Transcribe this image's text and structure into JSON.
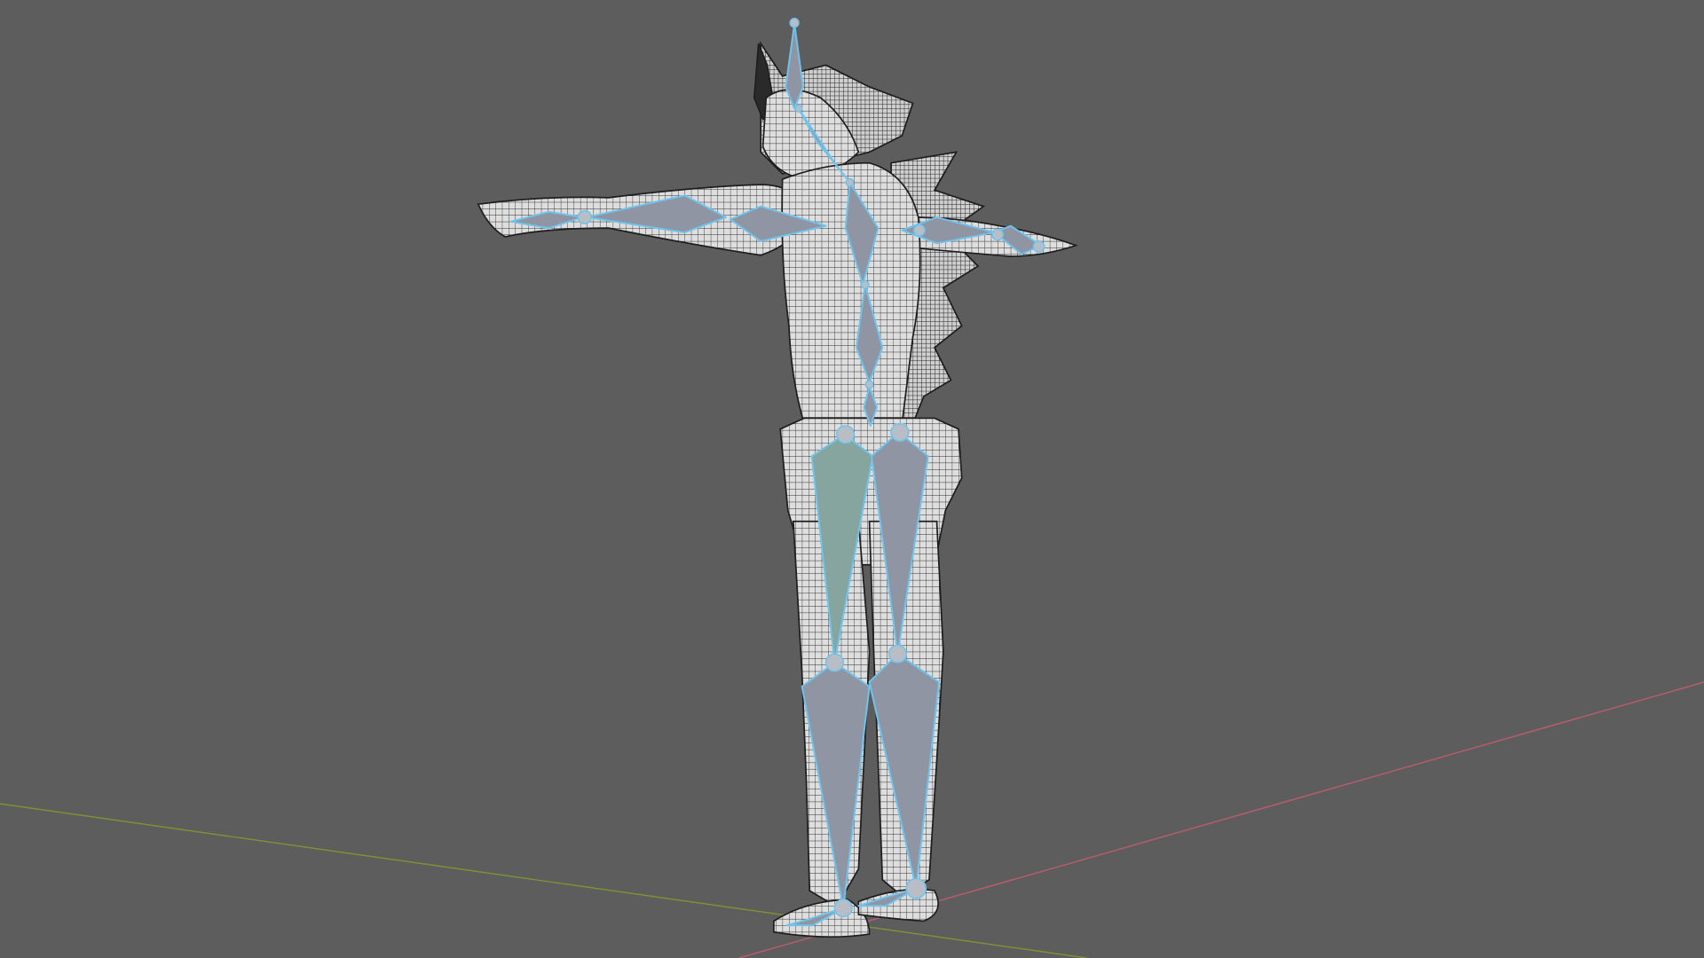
{
  "viewport": {
    "background": "#5d5d5d"
  },
  "colors": {
    "bone_fill": "#8f95a3",
    "bone_selected": "#86a59e",
    "bone_outline": "#6fc3ec",
    "joint": "#b9bec6",
    "mesh_fill": "#d9d9d9",
    "mesh_wire": "#2b2b2b",
    "axis_x": "#b85c6e",
    "axis_y": "#7c9234"
  },
  "icons": [
    "armature-bones",
    "wireframe-mesh",
    "grid-axis-x",
    "grid-axis-y"
  ]
}
